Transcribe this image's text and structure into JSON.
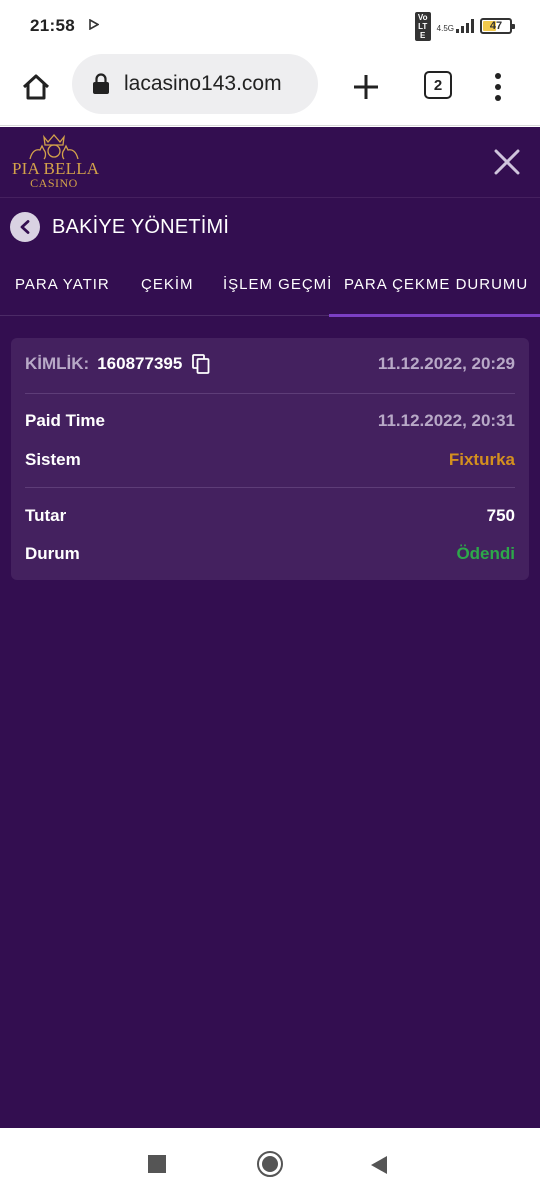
{
  "status_bar": {
    "time": "21:58",
    "play_icon": "play-arrow-icon",
    "volte": "Vo LTE",
    "network": "4.5G",
    "battery": "47",
    "battery_level": 0.47,
    "battery_color": "#f2c94c"
  },
  "browser": {
    "url": "lacasino143.com",
    "tab_count": "2"
  },
  "site": {
    "logo_line1": "PIA BELLA",
    "logo_line2": "CASINO",
    "page_title": "BAKİYE YÖNETİMİ",
    "tabs": [
      {
        "label": "PARA YATIR",
        "active": false
      },
      {
        "label": "ÇEKİM",
        "active": false
      },
      {
        "label": "İŞLEM GEÇMİ",
        "active": false
      },
      {
        "label": "PARA ÇEKME DURUMU",
        "active": true
      }
    ],
    "card": {
      "id_label": "KİMLİK:",
      "id_value": "160877395",
      "created": "11.12.2022, 20:29",
      "paid_time_label": "Paid Time",
      "paid_time_value": "11.12.2022, 20:31",
      "system_label": "Sistem",
      "system_value": "Fixturka",
      "amount_label": "Tutar",
      "amount_value": "750",
      "status_label": "Durum",
      "status_value": "Ödendi"
    }
  },
  "colors": {
    "site_bg": "#330e50",
    "card_bg": "#44215f",
    "accent": "#7b3fc4",
    "gold": "#d3a24a",
    "system_value": "#d4901e",
    "status_paid": "#2da84a"
  }
}
